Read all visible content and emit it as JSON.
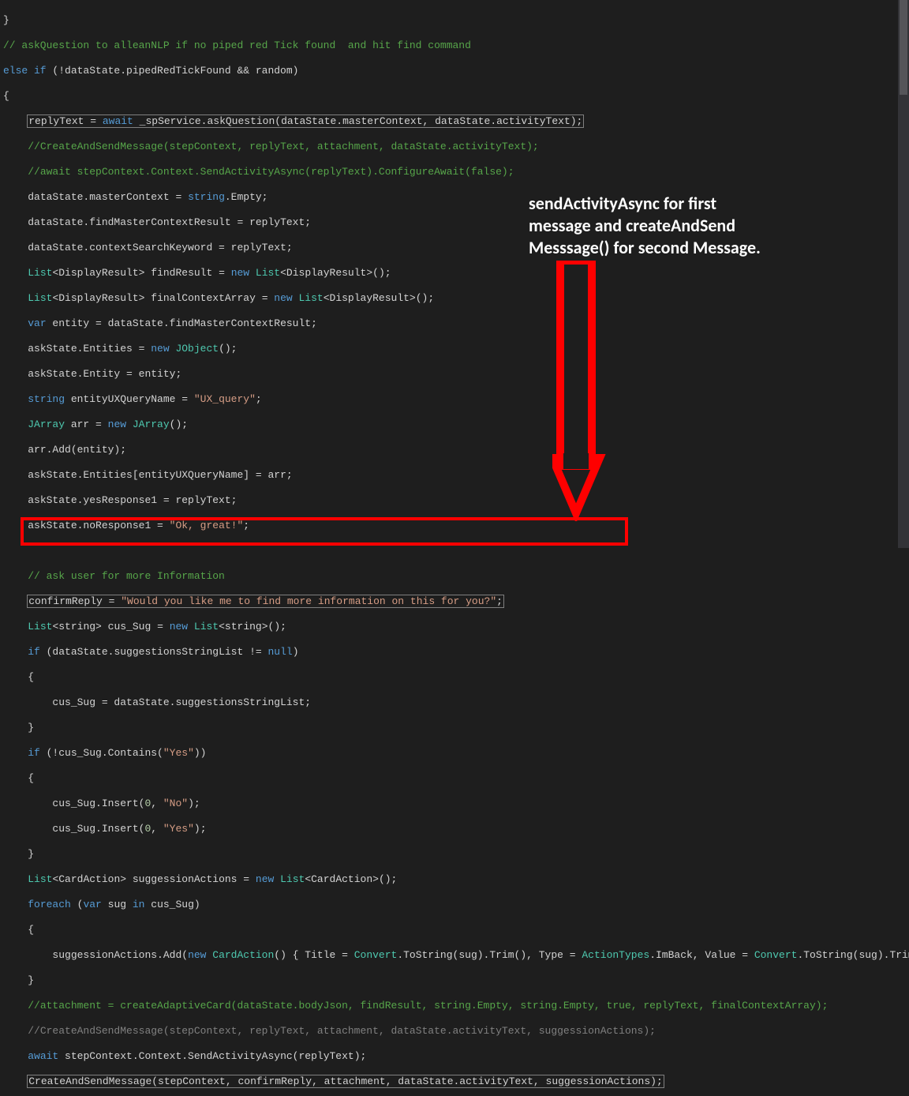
{
  "annotation": {
    "line1": "sendActivityAsync for first",
    "line2": "message and createAndSend",
    "line3": "Messsage() for second Message."
  },
  "code": {
    "l0": "}",
    "l1_a": "// askQuestion to alleanNLP if no piped red Tick found  and hit find command",
    "l2_a": "else if",
    "l2_b": " (!dataState.pipedRedTickFound && random)",
    "l3": "{",
    "l4_a": "replyText = ",
    "l4_b": "await",
    "l4_c": " _spService.askQuestion(dataState.masterContext, dataState.activityText);",
    "l5": "//CreateAndSendMessage(stepContext, replyText, attachment, dataState.activityText);",
    "l6": "//await stepContext.Context.SendActivityAsync(replyText).ConfigureAwait(false);",
    "l7_a": "dataState.masterContext = ",
    "l7_b": "string",
    "l7_c": ".Empty;",
    "l8": "dataState.findMasterContextResult = replyText;",
    "l9": "dataState.contextSearchKeyword = replyText;",
    "l10_a": "List",
    "l10_b": "<DisplayResult>",
    "l10_c": " findResult = ",
    "l10_d": "new",
    "l10_e": " List",
    "l10_f": "<DisplayResult>",
    "l10_g": "();",
    "l11_a": "List",
    "l11_b": "<DisplayResult>",
    "l11_c": " finalContextArray = ",
    "l11_d": "new",
    "l11_e": " List",
    "l11_f": "<DisplayResult>",
    "l11_g": "();",
    "l12_a": "var",
    "l12_b": " entity = dataState.findMasterContextResult;",
    "l13_a": "askState.Entities = ",
    "l13_b": "new",
    "l13_c": " JObject",
    "l13_d": "();",
    "l14": "askState.Entity = entity;",
    "l15_a": "string",
    "l15_b": " entityUXQueryName = ",
    "l15_c": "\"UX_query\"",
    "l15_d": ";",
    "l16_a": "JArray",
    "l16_b": " arr = ",
    "l16_c": "new",
    "l16_d": " JArray",
    "l16_e": "();",
    "l17": "arr.Add(entity);",
    "l18": "askState.Entities[entityUXQueryName] = arr;",
    "l19": "askState.yesResponse1 = replyText;",
    "l20_a": "askState.noResponse1 = ",
    "l20_b": "\"Ok, great!\"",
    "l20_c": ";",
    "l21": "",
    "l22": "// ask user for more Information",
    "l23_a": "confirmReply = ",
    "l23_b": "\"Would you like me to find more information on this for you?\"",
    "l23_c": ";",
    "l24_a": "List",
    "l24_b": "<string>",
    "l24_c": " cus_Sug = ",
    "l24_d": "new",
    "l24_e": " List",
    "l24_f": "<string>",
    "l24_g": "();",
    "l25_a": "if",
    "l25_b": " (dataState.suggestionsStringList != ",
    "l25_c": "null",
    "l25_d": ")",
    "l26": "{",
    "l27": "    cus_Sug = dataState.suggestionsStringList;",
    "l28": "}",
    "l29_a": "if",
    "l29_b": " (!cus_Sug.Contains(",
    "l29_c": "\"Yes\"",
    "l29_d": "))",
    "l30": "{",
    "l31_a": "    cus_Sug.Insert(",
    "l31_b": "0",
    "l31_c": ", ",
    "l31_d": "\"No\"",
    "l31_e": ");",
    "l32_a": "    cus_Sug.Insert(",
    "l32_b": "0",
    "l32_c": ", ",
    "l32_d": "\"Yes\"",
    "l32_e": ");",
    "l33": "}",
    "l34_a": "List",
    "l34_b": "<CardAction>",
    "l34_c": " suggessionActions = ",
    "l34_d": "new",
    "l34_e": " List",
    "l34_f": "<CardAction>",
    "l34_g": "();",
    "l35_a": "foreach",
    "l35_b": " (",
    "l35_c": "var",
    "l35_d": " sug ",
    "l35_e": "in",
    "l35_f": " cus_Sug)",
    "l36": "{",
    "l37_a": "    suggessionActions.Add(",
    "l37_b": "new",
    "l37_c": " CardAction",
    "l37_d": "() { Title = ",
    "l37_e": "Convert",
    "l37_f": ".ToString(sug).Trim(), Type = ",
    "l37_g": "ActionTypes",
    "l37_h": ".ImBack, Value = ",
    "l37_i": "Convert",
    "l37_j": ".ToString(sug).Trim() });",
    "l38": "}",
    "l39_a": "//attachment = createAdaptiveCard(dataState.bodyJson, findResult, string.Empty, string.Empty, true, replyText, finalContextArray);",
    "l40": "//CreateAndSendMessage(stepContext, replyText, attachment, dataState.activityText, suggessionActions);",
    "l41_a": "await",
    "l41_b": " stepContext.Context.SendActivityAsync(replyText);",
    "l42": "CreateAndSendMessage(stepContext, confirmReply, attachment, dataState.activityText, suggessionActions);"
  }
}
